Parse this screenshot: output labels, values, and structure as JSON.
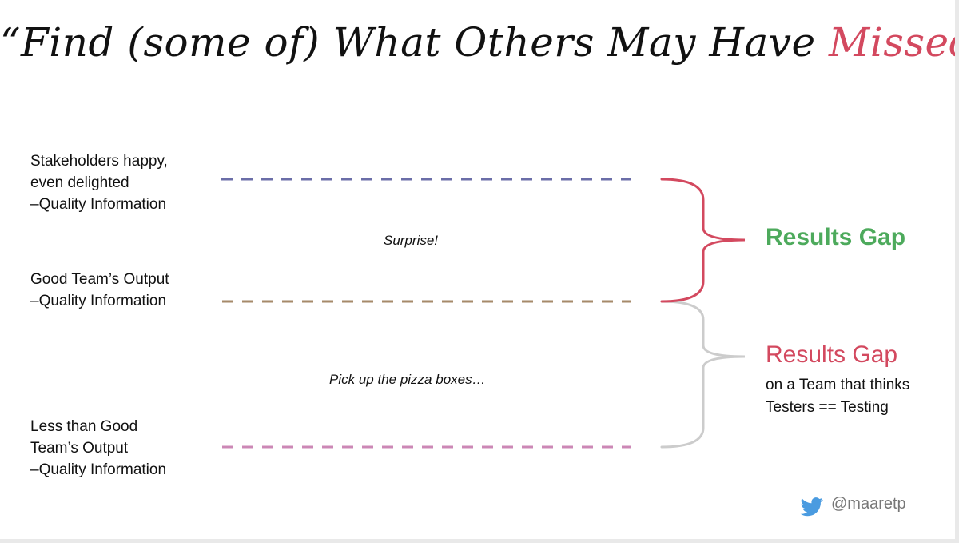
{
  "title": {
    "prefix": "“Find (some of) What Others May Have ",
    "highlight": "Missed",
    "suffix": "”",
    "highlight_color": "#d3495f"
  },
  "levels": [
    {
      "lines": [
        "Stakeholders happy,",
        "even delighted",
        "–Quality Information"
      ],
      "line_color": "#6b6ea8"
    },
    {
      "lines": [
        "Good Team’s Output",
        "–Quality Information"
      ],
      "line_color": "#a68a6a"
    },
    {
      "lines": [
        "Less than Good",
        "Team’s Output",
        "–Quality Information"
      ],
      "line_color": "#cc88b6"
    }
  ],
  "notes": {
    "surprise": "Surprise!",
    "pizza": "Pick up the pizza boxes…"
  },
  "gaps": {
    "upper": {
      "label": "Results Gap",
      "color": "#4daa5c"
    },
    "lower": {
      "label": "Results Gap",
      "sub": [
        "on a Team that thinks",
        "Testers == Testing"
      ],
      "color": "#d3495f"
    }
  },
  "brace_colors": {
    "upper": "#d3495f",
    "lower": "#cccccc"
  },
  "footer": {
    "handle": "@maaretp",
    "icon": "twitter-bird-icon",
    "icon_color": "#4a9be0"
  }
}
